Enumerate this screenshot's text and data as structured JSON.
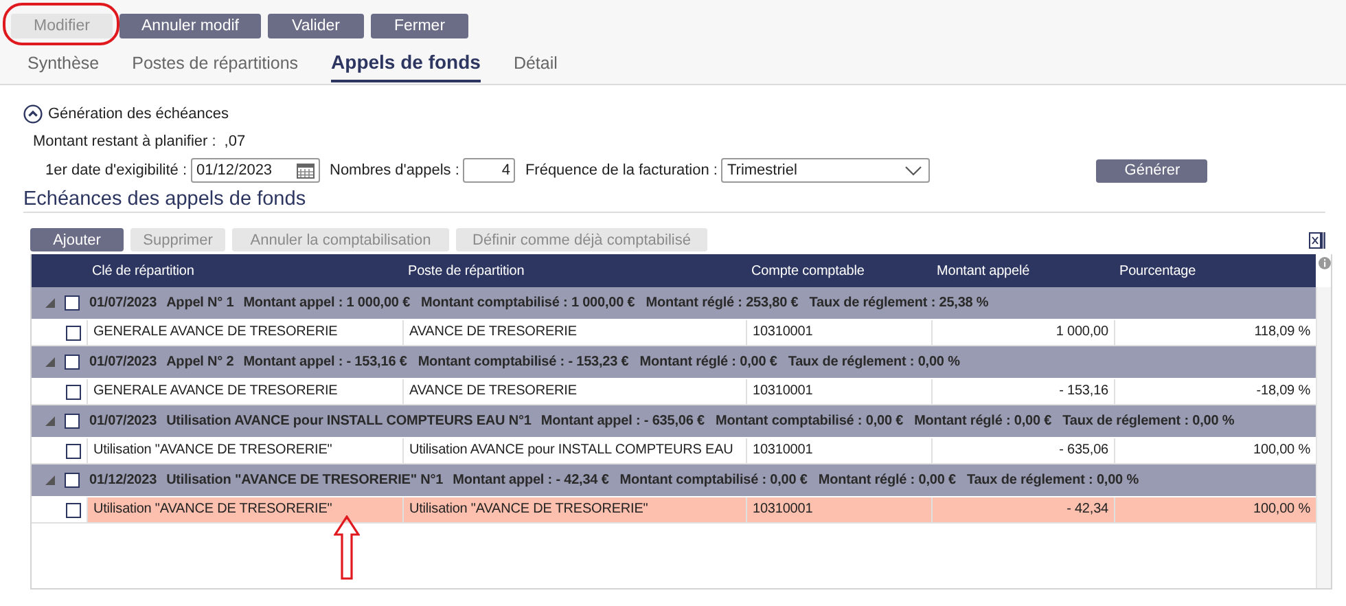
{
  "toolbar": {
    "buttons": [
      {
        "label": "Modifier",
        "disabled": true
      },
      {
        "label": "Annuler modif",
        "disabled": false
      },
      {
        "label": "Valider",
        "disabled": false
      },
      {
        "label": "Fermer",
        "disabled": false
      }
    ]
  },
  "tabs": [
    {
      "label": "Synthèse",
      "selected": false
    },
    {
      "label": "Postes de répartitions",
      "selected": false
    },
    {
      "label": "Appels de fonds",
      "selected": true
    },
    {
      "label": "Détail",
      "selected": false
    }
  ],
  "generation": {
    "title": "Génération des échéances",
    "expanded": true,
    "remaining": {
      "label": "Montant restant à planifier :",
      "value": ",07"
    },
    "first_date": {
      "label": "1er date d'exigibilité :",
      "value": "01/12/2023"
    },
    "call_count": {
      "label": "Nombres d'appels :",
      "value": "4"
    },
    "frequency": {
      "label": "Fréquence de la facturation :",
      "value": "Trimestriel"
    },
    "generate_button": "Générer"
  },
  "schedule": {
    "title": "Echéances des appels de fonds",
    "actions": [
      {
        "label": "Ajouter",
        "disabled": false
      },
      {
        "label": "Supprimer",
        "disabled": true
      },
      {
        "label": "Annuler la comptabilisation",
        "disabled": true
      },
      {
        "label": "Définir comme déjà comptabilisé",
        "disabled": true
      }
    ],
    "table": {
      "columns": [
        "Clé de répartition",
        "Poste de répartition",
        "Compte comptable",
        "Montant appelé",
        "Pourcentage"
      ],
      "groups": [
        {
          "expanded": true,
          "checked": false,
          "date": "01/07/2023",
          "title": "Appel N° 1",
          "fields": [
            {
              "label": "Montant appel :",
              "value": "1 000,00 €"
            },
            {
              "label": "Montant comptabilisé :",
              "value": "1 000,00 €"
            },
            {
              "label": "Montant réglé :",
              "value": "253,80 €"
            },
            {
              "label": "Taux de réglement :",
              "value": "25,38 %"
            }
          ],
          "rows": [
            {
              "checked": false,
              "selected": false,
              "cells": [
                "GENERALE AVANCE DE TRESORERIE",
                "AVANCE DE TRESORERIE",
                "10310001",
                "1 000,00",
                "118,09 %"
              ]
            }
          ]
        },
        {
          "expanded": true,
          "checked": false,
          "date": "01/07/2023",
          "title": "Appel N° 2",
          "fields": [
            {
              "label": "Montant appel :",
              "value": "- 153,16 €"
            },
            {
              "label": "Montant comptabilisé :",
              "value": "- 153,23 €"
            },
            {
              "label": "Montant réglé :",
              "value": "0,00 €"
            },
            {
              "label": "Taux de réglement :",
              "value": "0,00 %"
            }
          ],
          "rows": [
            {
              "checked": false,
              "selected": false,
              "cells": [
                "GENERALE AVANCE DE TRESORERIE",
                "AVANCE DE TRESORERIE",
                "10310001",
                "- 153,16",
                "-18,09 %"
              ]
            }
          ]
        },
        {
          "expanded": true,
          "checked": false,
          "date": "01/07/2023",
          "title": "Utilisation AVANCE pour INSTALL COMPTEURS EAU N°1",
          "fields": [
            {
              "label": "Montant appel :",
              "value": "- 635,06 €"
            },
            {
              "label": "Montant comptabilisé :",
              "value": "0,00 €"
            },
            {
              "label": "Montant réglé :",
              "value": "0,00 €"
            },
            {
              "label": "Taux de réglement :",
              "value": "0,00 %"
            }
          ],
          "rows": [
            {
              "checked": false,
              "selected": false,
              "cells": [
                "Utilisation \"AVANCE DE TRESORERIE\"",
                "Utilisation AVANCE pour INSTALL COMPTEURS EAU",
                "10310001",
                "- 635,06",
                "100,00 %"
              ]
            }
          ]
        },
        {
          "expanded": true,
          "checked": false,
          "date": "01/12/2023",
          "title": "Utilisation \"AVANCE DE TRESORERIE\" N°1",
          "fields": [
            {
              "label": "Montant appel :",
              "value": "- 42,34 €"
            },
            {
              "label": "Montant comptabilisé :",
              "value": "0,00 €"
            },
            {
              "label": "Montant réglé :",
              "value": "0,00 €"
            },
            {
              "label": "Taux de réglement :",
              "value": "0,00 %"
            }
          ],
          "rows": [
            {
              "checked": false,
              "selected": true,
              "cells": [
                "Utilisation \"AVANCE DE TRESORERIE\"",
                "Utilisation \"AVANCE DE TRESORERIE\"",
                "10310001",
                "- 42,34",
                "100,00 %"
              ]
            }
          ]
        }
      ]
    }
  }
}
